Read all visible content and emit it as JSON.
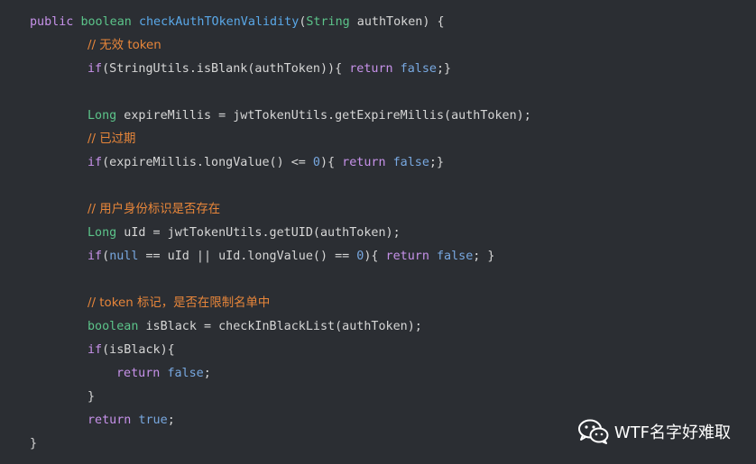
{
  "code": {
    "l1": {
      "kw": "public",
      "ty": "boolean",
      "fn": "checkAuthTOkenValidity",
      "p1": "(",
      "ty2": "String",
      "p2": " authToken) {"
    },
    "l2": {
      "cm": "// 无效 token"
    },
    "l3": {
      "kw": "if",
      "p1": "(StringUtils.isBlank(authToken)){ ",
      "kw2": "return",
      "sp": " ",
      "lit": "false",
      "p2": ";}"
    },
    "l5": {
      "ty": "Long",
      "p1": " expireMillis = jwtTokenUtils.getExpireMillis(authToken);"
    },
    "l6": {
      "cm": "// 已过期"
    },
    "l7": {
      "kw": "if",
      "p1": "(expireMillis.longValue() <= ",
      "n": "0",
      "p2": "){ ",
      "kw2": "return",
      "sp": " ",
      "lit": "false",
      "p3": ";}"
    },
    "l9": {
      "cm": "// 用户身份标识是否存在"
    },
    "l10": {
      "ty": "Long",
      "p1": " uId = jwtTokenUtils.getUID(authToken);"
    },
    "l11": {
      "kw": "if",
      "p1": "(",
      "lit1": "null",
      "p2": " == uId || uId.longValue() == ",
      "n": "0",
      "p3": "){ ",
      "kw2": "return",
      "sp": " ",
      "lit2": "false",
      "p4": "; }"
    },
    "l13": {
      "cm": "// token 标记，是否在限制名单中"
    },
    "l14": {
      "ty": "boolean",
      "p1": " isBlack = checkInBlackList(authToken);"
    },
    "l15": {
      "kw": "if",
      "p1": "(isBlack){"
    },
    "l16": {
      "kw": "return",
      "sp": " ",
      "lit": "false",
      "p1": ";"
    },
    "l17": {
      "p1": "}"
    },
    "l18": {
      "kw": "return",
      "sp": " ",
      "lit": "true",
      "p1": ";"
    },
    "l19": {
      "p1": "}"
    }
  },
  "watermark": {
    "text": "WTF名字好难取",
    "icon": "wechat-icon"
  },
  "colors": {
    "background": "#2b2e33",
    "keyword": "#c792ea",
    "type": "#5cc48a",
    "function": "#5aa8e8",
    "literal": "#78a8e0",
    "comment": "#e8863a",
    "text": "#d6d6d6"
  }
}
